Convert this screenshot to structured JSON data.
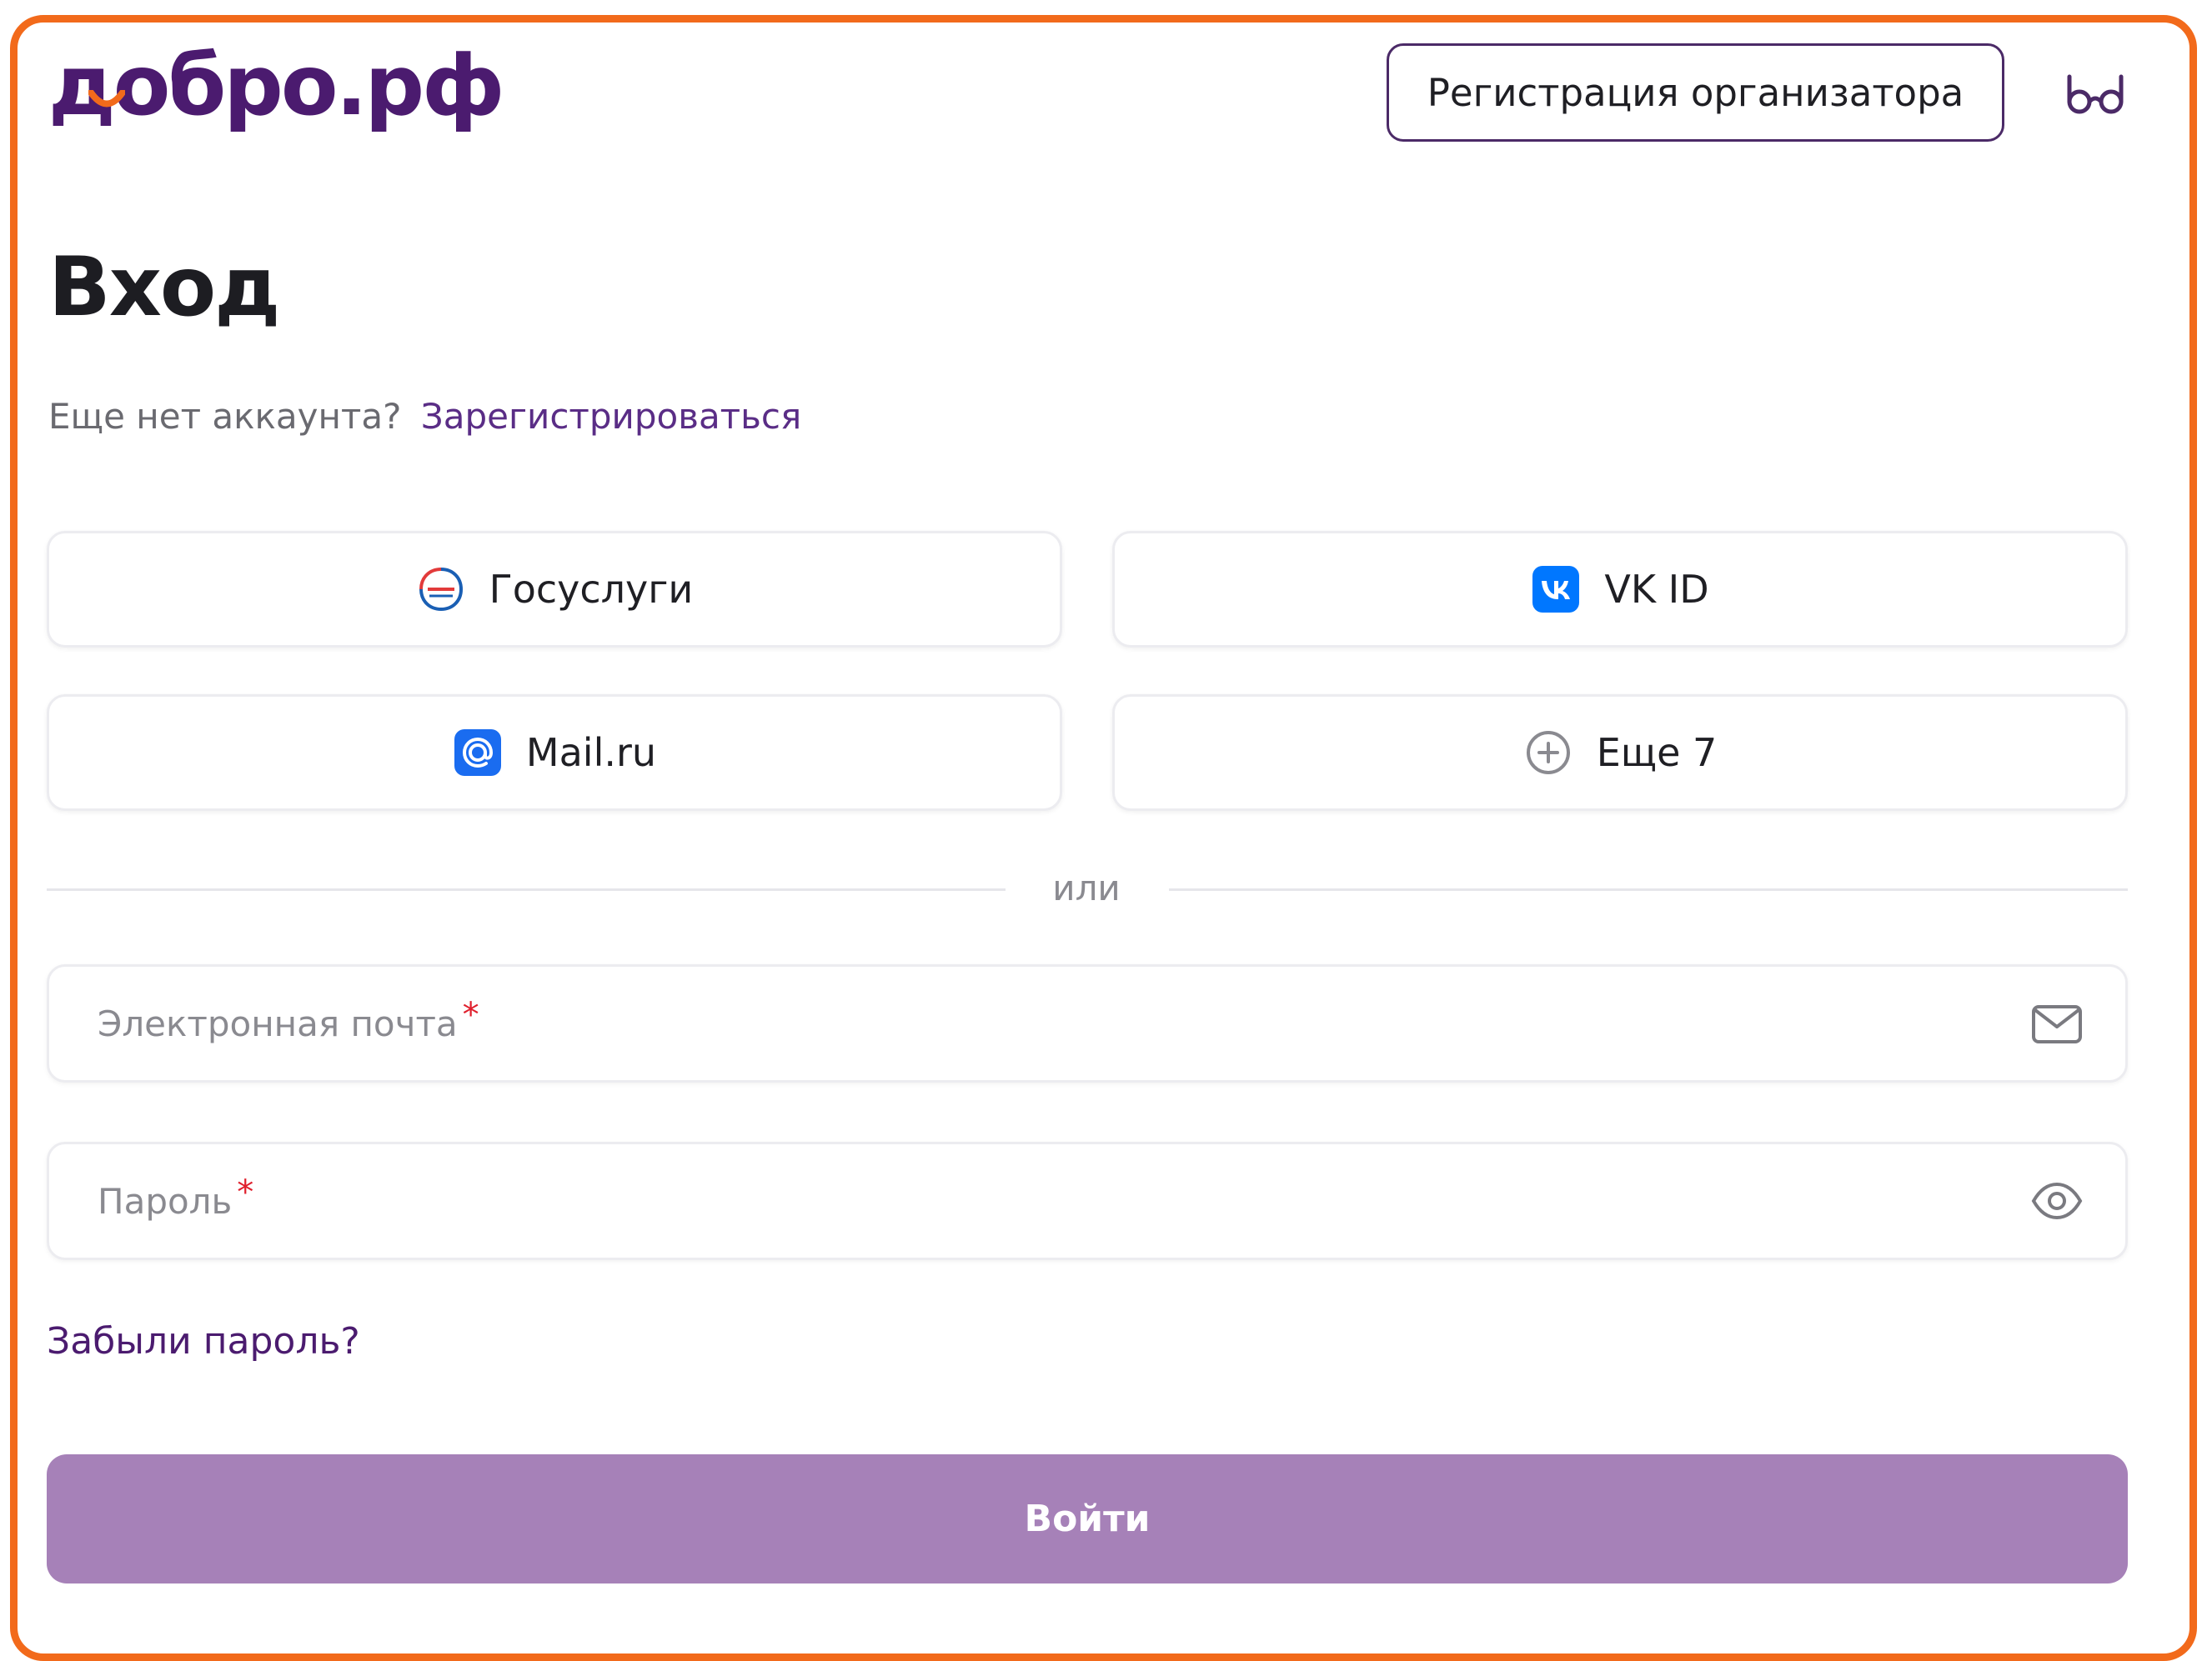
{
  "header": {
    "logo_text": "добро.рф",
    "organizer_button": "Регистрация организатора",
    "accessibility_icon": "glasses-icon"
  },
  "login": {
    "title": "Вход",
    "no_account_text": "Еще нет аккаунта?",
    "register_link": "Зарегистрироваться",
    "providers": {
      "gosuslugi": "Госуслуги",
      "vk": "VK ID",
      "mail": "Mail.ru",
      "more": "Еще 7"
    },
    "divider_text": "или",
    "email_placeholder": "Электронная почта",
    "password_placeholder": "Пароль",
    "required_mark": "*",
    "forgot_password": "Забыли пароль?",
    "submit": "Войти"
  },
  "colors": {
    "frame_border": "#f26a1b",
    "brand_purple": "#4b1b6f",
    "submit_bg": "#a681b8",
    "vk_blue": "#0077ff",
    "mail_blue": "#1a6cf0",
    "required_red": "#e0202d"
  }
}
